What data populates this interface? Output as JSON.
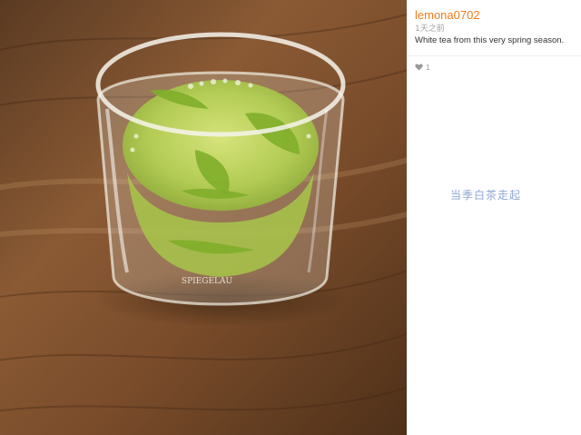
{
  "post": {
    "username": "lemona0702",
    "timestamp": "1天之前",
    "caption": "White tea from this very spring season.",
    "like_count": "1",
    "like_icon": "heart-icon"
  },
  "photo": {
    "subject": "glass cup of green tea",
    "cup_brand_text": "SPIEGELAU"
  },
  "watermark": {
    "text": "当季白茶走起"
  },
  "colors": {
    "username": "#f07b1d",
    "watermark": "#8ea6d6",
    "background": "#ffffff"
  }
}
